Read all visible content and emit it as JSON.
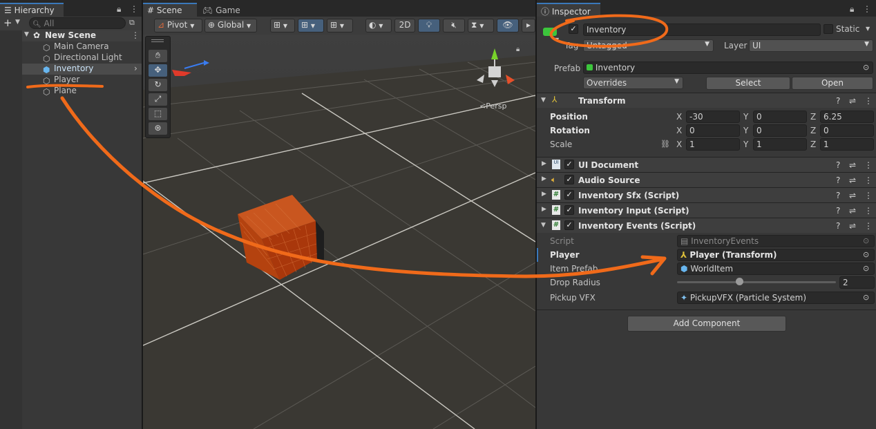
{
  "hierarchy": {
    "tab_label": "Hierarchy",
    "search_placeholder": "All",
    "scene_name": "New Scene",
    "items": [
      {
        "label": "Main Camera"
      },
      {
        "label": "Directional Light"
      },
      {
        "label": "Inventory"
      },
      {
        "label": "Player"
      },
      {
        "label": "Plane"
      }
    ]
  },
  "scene_view": {
    "tabs": [
      {
        "label": "Scene"
      },
      {
        "label": "Game"
      }
    ],
    "toolbar": {
      "pivot_label": "Pivot",
      "global_label": "Global",
      "mode_2d": "2D"
    },
    "persp_label": "<Persp"
  },
  "inspector": {
    "tab_label": "Inspector",
    "object_name": "Inventory",
    "static_label": "Static",
    "tag_label": "Tag",
    "tag_value": "Untagged",
    "layer_label": "Layer",
    "layer_value": "UI",
    "prefab_label": "Prefab",
    "prefab_value": "Inventory",
    "overrides_label": "Overrides",
    "select_label": "Select",
    "open_label": "Open",
    "transform": {
      "title": "Transform",
      "position_label": "Position",
      "rotation_label": "Rotation",
      "scale_label": "Scale",
      "position": {
        "x": "-30",
        "y": "0",
        "z": "6.25"
      },
      "rotation": {
        "x": "0",
        "y": "0",
        "z": "0"
      },
      "scale": {
        "x": "1",
        "y": "1",
        "z": "1"
      }
    },
    "components": [
      {
        "title": "UI Document"
      },
      {
        "title": "Audio Source"
      },
      {
        "title": "Inventory Sfx (Script)"
      },
      {
        "title": "Inventory Input (Script)"
      },
      {
        "title": "Inventory Events (Script)"
      }
    ],
    "events": {
      "script_label": "Script",
      "script_value": "InventoryEvents",
      "player_label": "Player",
      "player_value": "Player (Transform)",
      "item_prefab_label": "Item Prefab",
      "item_prefab_value": "WorldItem",
      "drop_radius_label": "Drop Radius",
      "drop_radius_value": "2",
      "drop_radius_fraction": 0.39,
      "pickup_vfx_label": "Pickup VFX",
      "pickup_vfx_value": "PickupVFX (Particle System)"
    },
    "add_component_label": "Add Component"
  },
  "axis_letters": {
    "x": "X",
    "y": "Y",
    "z": "Z"
  },
  "colors": {
    "accent": "#3a79bb",
    "annotation": "#f06a1a",
    "cube": "#c2420f",
    "prefab_green": "#3cc63c"
  }
}
